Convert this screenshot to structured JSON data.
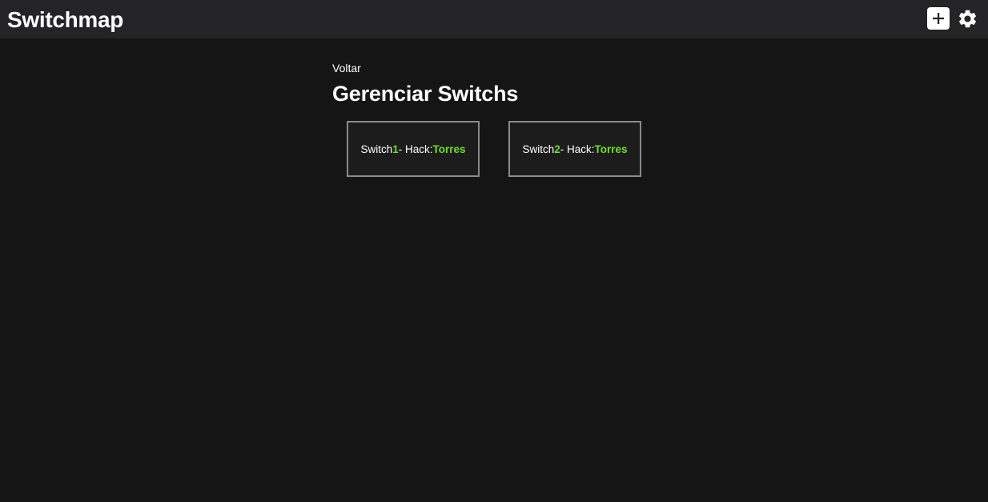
{
  "header": {
    "title": "Switchmap",
    "add_icon": "plus-icon",
    "settings_icon": "gear-icon"
  },
  "main": {
    "back_label": "Voltar",
    "title": "Gerenciar Switchs",
    "cards": [
      {
        "prefix": "Switch",
        "number": "1",
        "middle": "- Hack:",
        "location": "Torres"
      },
      {
        "prefix": "Switch",
        "number": "2",
        "middle": "- Hack:",
        "location": "Torres"
      }
    ]
  },
  "colors": {
    "background": "#151515",
    "topbar": "#242427",
    "accent": "#6ee02a",
    "card_border": "#8a8a8a"
  }
}
